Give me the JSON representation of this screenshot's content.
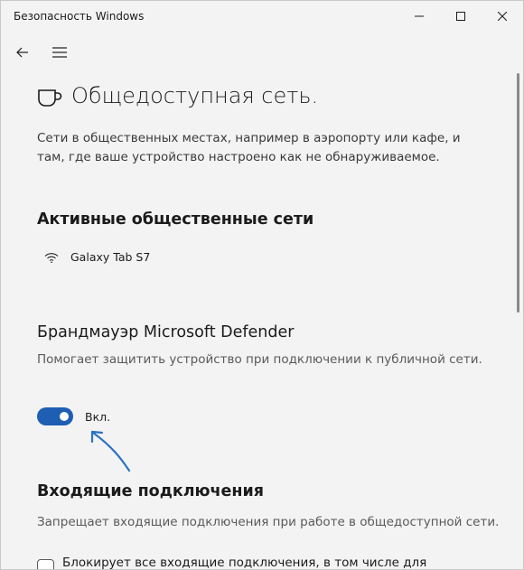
{
  "window": {
    "title": "Безопасность Windows"
  },
  "nav": {
    "back_icon": "back-arrow-icon",
    "menu_icon": "hamburger-menu-icon"
  },
  "page": {
    "icon": "coffee-cup-icon",
    "title": "Общедоступная сеть.",
    "description": "Сети в общественных местах, например в аэропорту или кафе, и там, где ваше устройство настроено как не обнаруживаемое."
  },
  "active_networks": {
    "heading": "Активные общественные сети",
    "items": [
      {
        "icon": "wifi-icon",
        "label": "Galaxy Tab S7"
      }
    ]
  },
  "firewall": {
    "heading": "Брандмауэр Microsoft Defender",
    "description": "Помогает защитить устройство при подключении к публичной сети.",
    "toggle_state": "on",
    "toggle_label": "Вкл.",
    "accent_color": "#1e5fb4"
  },
  "incoming": {
    "heading": "Входящие подключения",
    "description": "Запрещает входящие подключения при работе в общедоступной сети.",
    "checkbox_checked": false,
    "checkbox_label": "Блокирует все входящие подключения, в том числе для"
  },
  "annotation": {
    "arrow_color": "#2a72c2"
  }
}
